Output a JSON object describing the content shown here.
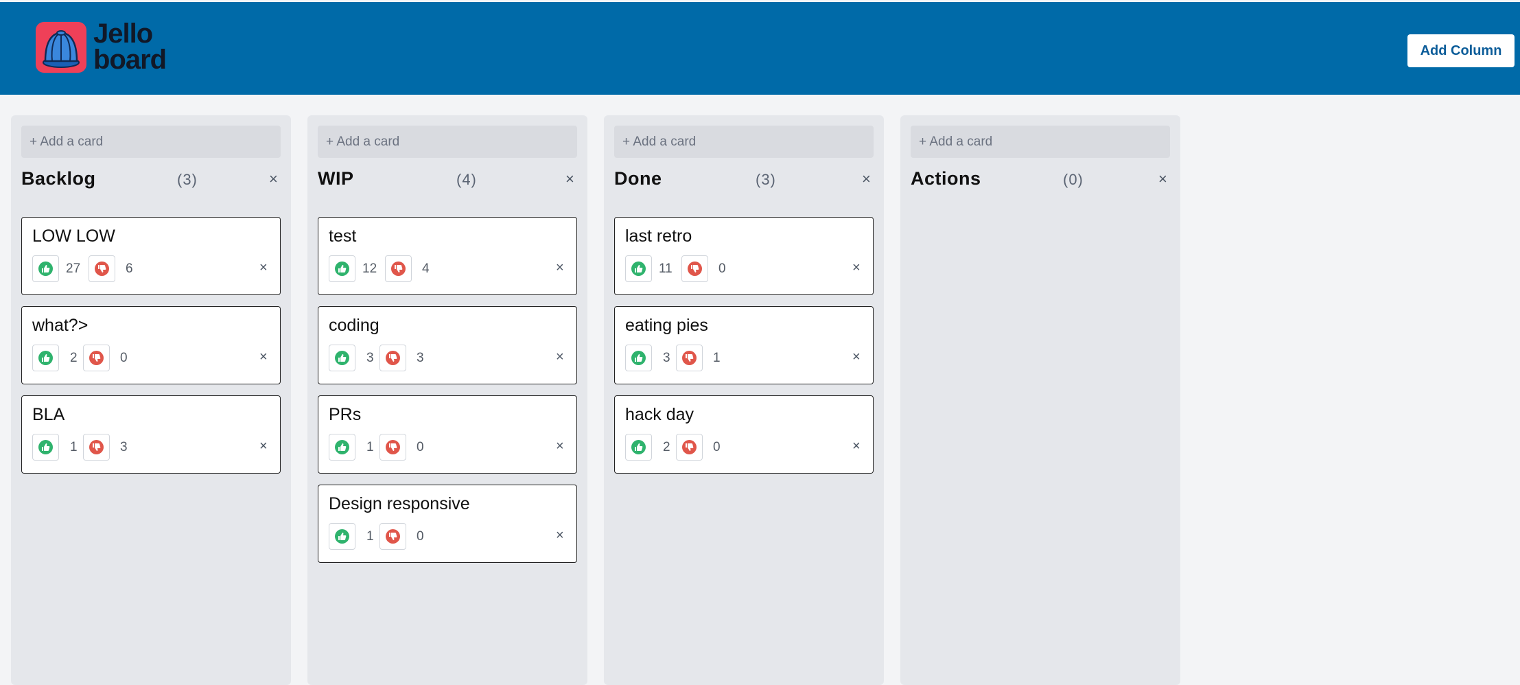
{
  "header": {
    "logo_line1": "Jello",
    "logo_line2": "board",
    "add_column_label": "Add Column",
    "background": "#006aa8"
  },
  "board": {
    "add_card_placeholder": "+ Add a card",
    "close_glyph": "×",
    "columns": [
      {
        "title": "Backlog",
        "count": "(3)",
        "cards": [
          {
            "title": "LOW LOW",
            "up": "27",
            "down": "6"
          },
          {
            "title": "what?>",
            "up": "2",
            "down": "0"
          },
          {
            "title": "BLA",
            "up": "1",
            "down": "3"
          }
        ]
      },
      {
        "title": "WIP",
        "count": "(4)",
        "cards": [
          {
            "title": "test",
            "up": "12",
            "down": "4"
          },
          {
            "title": "coding",
            "up": "3",
            "down": "3"
          },
          {
            "title": "PRs",
            "up": "1",
            "down": "0"
          },
          {
            "title": "Design responsive",
            "up": "1",
            "down": "0"
          }
        ]
      },
      {
        "title": "Done",
        "count": "(3)",
        "cards": [
          {
            "title": "last retro",
            "up": "11",
            "down": "0"
          },
          {
            "title": "eating pies",
            "up": "3",
            "down": "1"
          },
          {
            "title": "hack day",
            "up": "2",
            "down": "0"
          }
        ]
      },
      {
        "title": "Actions",
        "count": "(0)",
        "cards": []
      }
    ]
  },
  "colors": {
    "upvote": "#2fb36d",
    "downvote": "#e0564a",
    "logo_bg": "#ef4058"
  },
  "icons": {
    "upvote": "thumbs-up-icon",
    "downvote": "thumbs-down-icon",
    "close": "close-icon",
    "logo": "jelly-mould-icon"
  }
}
